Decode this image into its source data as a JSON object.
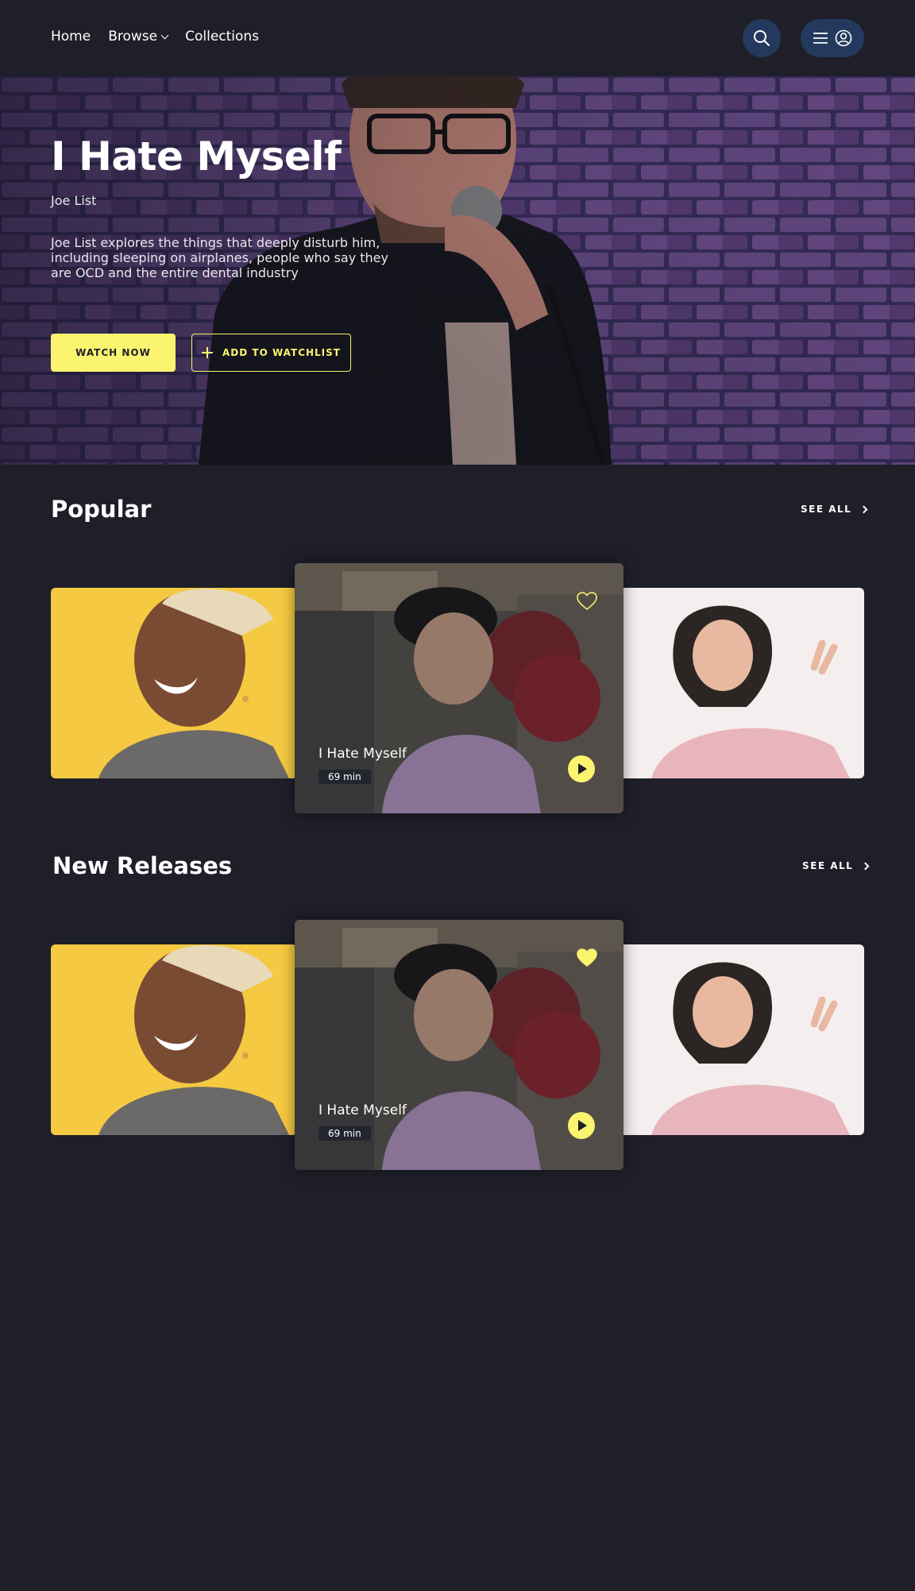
{
  "nav": {
    "home": "Home",
    "browse": "Browse",
    "collections": "Collections"
  },
  "hero": {
    "title": "I Hate Myself",
    "subtitle": "Joe List",
    "description": "Joe List explores the things that deeply disturb him, including sleeping on airplanes, people who say they are OCD and the entire dental industry",
    "watch_label": "WATCH NOW",
    "watchlist_label": "ADD TO WATCHLIST"
  },
  "sections": [
    {
      "title": "Popular",
      "see_all": "SEE ALL",
      "featured": {
        "title": "I Hate Myself",
        "duration": "69 min",
        "favorited": false
      }
    },
    {
      "title": "New Releases",
      "see_all": "SEE ALL",
      "featured": {
        "title": "I Hate Myself",
        "duration": "69 min",
        "favorited": true
      }
    }
  ],
  "colors": {
    "background": "#1e1f29",
    "accent": "#fbf46f",
    "icon_button": "#233a5e"
  },
  "icons": [
    "search-icon",
    "hamburger-icon",
    "user-icon",
    "chevron-down-icon",
    "plus-icon",
    "chevron-right-icon",
    "heart-icon",
    "play-icon"
  ]
}
